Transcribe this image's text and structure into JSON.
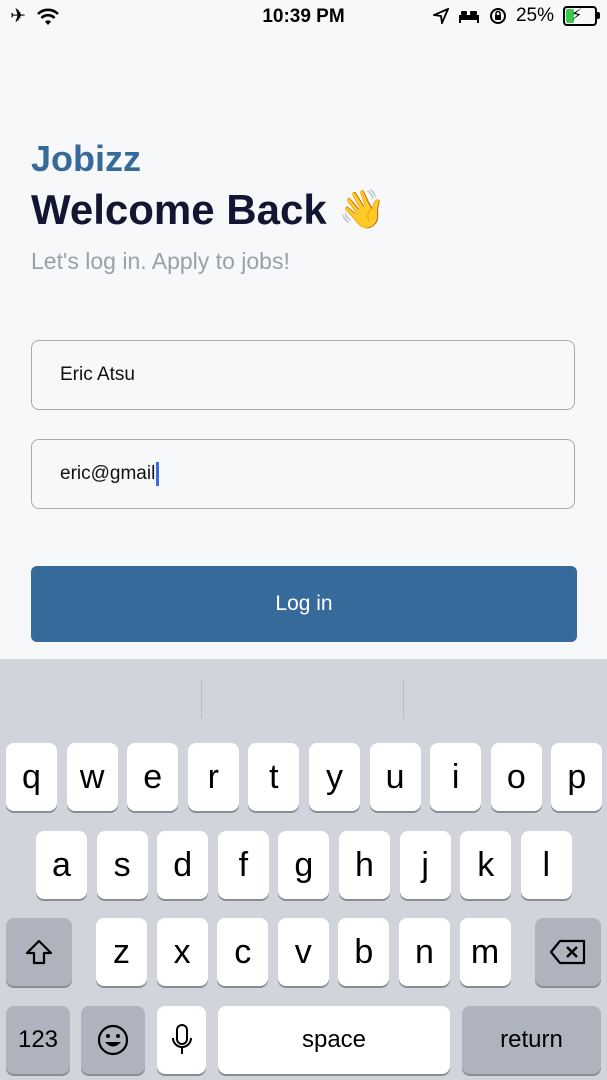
{
  "status_bar": {
    "time": "10:39 PM",
    "battery": "25%",
    "battery_level": 0.25,
    "icons": [
      "airplane-icon",
      "wifi-icon",
      "location-icon",
      "bed-icon",
      "orientation-lock-icon",
      "battery-icon"
    ]
  },
  "header": {
    "brand": "Jobizz",
    "title": "Welcome Back",
    "title_emoji": "👋",
    "subtitle": "Let's log in. Apply to jobs!"
  },
  "form": {
    "name_value": "Eric Atsu",
    "email_value": "eric@gmail",
    "login_label": "Log in"
  },
  "keyboard": {
    "row1": [
      "q",
      "w",
      "e",
      "r",
      "t",
      "y",
      "u",
      "i",
      "o",
      "p"
    ],
    "row2": [
      "a",
      "s",
      "d",
      "f",
      "g",
      "h",
      "j",
      "k",
      "l"
    ],
    "row3": [
      "z",
      "x",
      "c",
      "v",
      "b",
      "n",
      "m"
    ],
    "numbers_label": "123",
    "space_label": "space",
    "return_label": "return"
  },
  "colors": {
    "brand": "#356a9a",
    "title": "#121632",
    "subtitle": "#9aa0a8",
    "background": "#f7f8fa",
    "keyboard": "#d1d4da"
  }
}
